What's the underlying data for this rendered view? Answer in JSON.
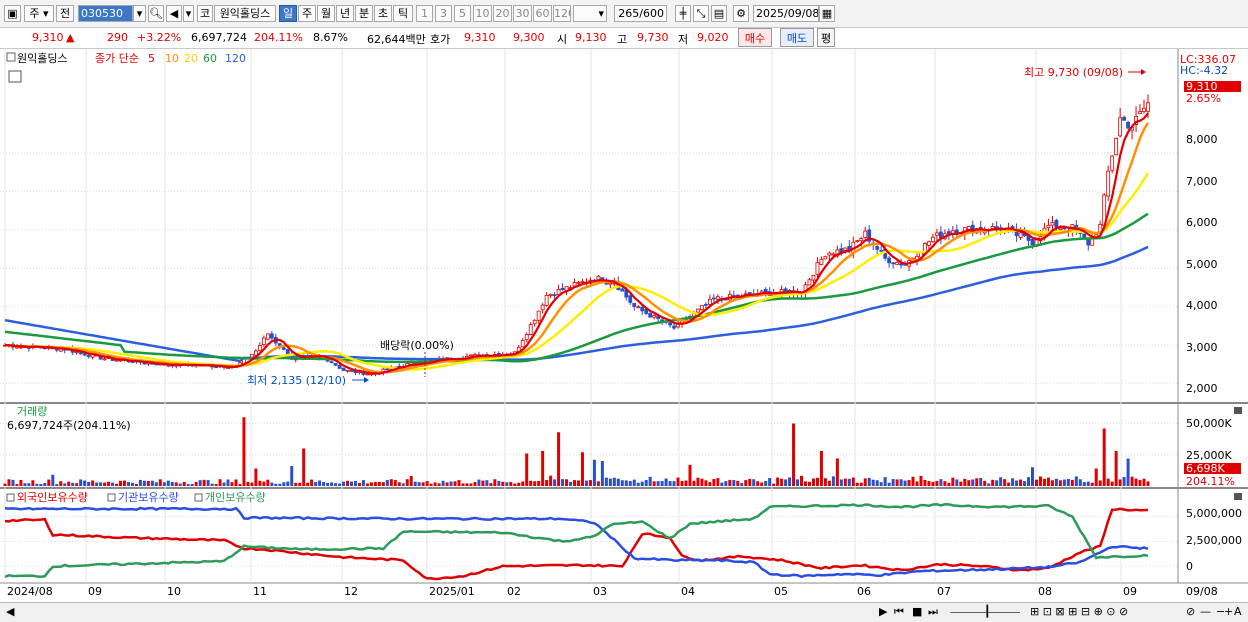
{
  "toolbar": {
    "market": "주",
    "prev": "전",
    "code": "030530",
    "market_type": "코",
    "name": "원익홀딩스",
    "periods": [
      "일",
      "주",
      "월",
      "년",
      "분",
      "초",
      "틱"
    ],
    "period_selected": "일",
    "nums": [
      "1",
      "3",
      "5",
      "10",
      "20",
      "30",
      "60",
      "120"
    ],
    "count": "265",
    "count_max": "/600",
    "date": "2025/09/08"
  },
  "info": {
    "price": "9,310",
    "arrow": "▲",
    "change": "290",
    "change_pct": "+3.22%",
    "volume": "6,697,724",
    "vol_ratio": "204.11%",
    "turnover": "8.67%",
    "amount": "62,644백만",
    "quote_label": "호가",
    "ask": "9,310",
    "bid": "9,300",
    "open_label": "시",
    "open": "9,130",
    "high_label": "고",
    "high": "9,730",
    "low_label": "저",
    "low": "9,020",
    "buy": "매수",
    "sell": "매도",
    "avg": "평"
  },
  "colors": {
    "up": "#e00000",
    "down": "#2a50c8",
    "ma5": "#e00000",
    "ma10": "#ff9000",
    "ma20": "#ffee00",
    "ma60": "#1a9a40",
    "ma120": "#2a60e0",
    "foreign": "#e00000",
    "inst": "#2a4ee0",
    "indiv": "#2e9a5a"
  },
  "chart_data": [
    {
      "type": "candlestick",
      "title": "원익홀딩스",
      "legend": {
        "label": "종가 단순",
        "ma": [
          "5",
          "10",
          "20",
          "60",
          "120"
        ]
      },
      "x_labels": [
        "2024/08",
        "09",
        "10",
        "11",
        "12",
        "2025/01",
        "02",
        "03",
        "04",
        "05",
        "06",
        "07",
        "08",
        "09"
      ],
      "y_ticks": [
        "8,000",
        "7,000",
        "6,000",
        "5,000",
        "4,000",
        "3,000",
        "2,000"
      ],
      "ylim": [
        1600,
        10500
      ],
      "annotations": {
        "high": "최고 9,730 (09/08)",
        "low": "최저 2,135 (12/10)",
        "dividend": "배당락(0.00%)",
        "lc": "LC:336.07",
        "hc": "HC:-4.32",
        "last": "9,310",
        "last_pct": "2.65%"
      },
      "anchors": [
        [
          0,
          3000
        ],
        [
          15,
          2900
        ],
        [
          25,
          2650
        ],
        [
          40,
          2500
        ],
        [
          58,
          2450
        ],
        [
          63,
          2850
        ],
        [
          66,
          3300
        ],
        [
          72,
          2650
        ],
        [
          80,
          2700
        ],
        [
          85,
          2350
        ],
        [
          92,
          2250
        ],
        [
          100,
          2480
        ],
        [
          105,
          2560
        ],
        [
          115,
          2700
        ],
        [
          128,
          2800
        ],
        [
          133,
          3700
        ],
        [
          136,
          4300
        ],
        [
          148,
          4750
        ],
        [
          153,
          4650
        ],
        [
          158,
          4000
        ],
        [
          168,
          3450
        ],
        [
          178,
          4200
        ],
        [
          190,
          4350
        ],
        [
          200,
          4400
        ],
        [
          206,
          5400
        ],
        [
          212,
          5500
        ],
        [
          216,
          5900
        ],
        [
          221,
          5250
        ],
        [
          226,
          5100
        ],
        [
          233,
          5800
        ],
        [
          238,
          6000
        ],
        [
          250,
          6050
        ],
        [
          258,
          5700
        ],
        [
          262,
          6100
        ],
        [
          268,
          6050
        ],
        [
          272,
          5650
        ],
        [
          275,
          6100
        ],
        [
          277,
          7500
        ],
        [
          280,
          8900
        ],
        [
          283,
          8700
        ],
        [
          287,
          9310
        ]
      ]
    },
    {
      "type": "bar",
      "title": "거래량",
      "readout": "6,697,724주(204.11%)",
      "y_ticks": [
        "50,000K",
        "25,000K",
        "0"
      ],
      "ylim": [
        0,
        60000
      ],
      "last": "6,698K",
      "last_pct": "204.11%",
      "spikes": [
        [
          12,
          9000
        ],
        [
          60,
          55000
        ],
        [
          63,
          14000
        ],
        [
          72,
          16000
        ],
        [
          75,
          30000
        ],
        [
          102,
          8000
        ],
        [
          131,
          26000
        ],
        [
          135,
          28000
        ],
        [
          139,
          43000
        ],
        [
          145,
          27000
        ],
        [
          148,
          21000
        ],
        [
          150,
          20000
        ],
        [
          172,
          17000
        ],
        [
          198,
          50000
        ],
        [
          205,
          28000
        ],
        [
          209,
          22000
        ],
        [
          258,
          15000
        ],
        [
          274,
          14000
        ],
        [
          276,
          46000
        ],
        [
          279,
          28000
        ],
        [
          282,
          22000
        ]
      ]
    },
    {
      "type": "line",
      "legend": [
        "외국인보유수량",
        "기관보유수량",
        "개인보유수량"
      ],
      "y_ticks": [
        "5,000,000",
        "2,500,000",
        "0"
      ],
      "ylim": [
        -1500000,
        6800000
      ],
      "series": [
        {
          "name": "외국인보유수량",
          "anchors": [
            [
              0,
              4600000
            ],
            [
              10,
              4700000
            ],
            [
              12,
              3200000
            ],
            [
              30,
              2900000
            ],
            [
              55,
              2600000
            ],
            [
              60,
              1800000
            ],
            [
              65,
              1700000
            ],
            [
              75,
              1300000
            ],
            [
              85,
              900000
            ],
            [
              100,
              600000
            ],
            [
              106,
              -1300000
            ],
            [
              115,
              -1000000
            ],
            [
              125,
              0
            ],
            [
              145,
              100000
            ],
            [
              155,
              0
            ],
            [
              160,
              3300000
            ],
            [
              167,
              2900000
            ],
            [
              170,
              1000000
            ],
            [
              175,
              600000
            ],
            [
              185,
              1000000
            ],
            [
              195,
              600000
            ],
            [
              205,
              -200000
            ],
            [
              215,
              100000
            ],
            [
              225,
              -400000
            ],
            [
              235,
              200000
            ],
            [
              245,
              0
            ],
            [
              255,
              -400000
            ],
            [
              262,
              -200000
            ],
            [
              270,
              1400000
            ],
            [
              275,
              2000000
            ],
            [
              278,
              5800000
            ],
            [
              287,
              5600000
            ]
          ]
        },
        {
          "name": "기관보유수량",
          "anchors": [
            [
              0,
              5800000
            ],
            [
              58,
              5800000
            ],
            [
              60,
              4900000
            ],
            [
              100,
              4800000
            ],
            [
              140,
              4800000
            ],
            [
              148,
              4400000
            ],
            [
              152,
              3000000
            ],
            [
              158,
              800000
            ],
            [
              168,
              600000
            ],
            [
              178,
              600000
            ],
            [
              188,
              400000
            ],
            [
              192,
              -800000
            ],
            [
              200,
              -1000000
            ],
            [
              210,
              -800000
            ],
            [
              220,
              -900000
            ],
            [
              230,
              -500000
            ],
            [
              250,
              -300000
            ],
            [
              262,
              -100000
            ],
            [
              270,
              400000
            ],
            [
              278,
              2000000
            ],
            [
              287,
              1800000
            ]
          ]
        },
        {
          "name": "개인보유수량",
          "anchors": [
            [
              0,
              -1000000
            ],
            [
              10,
              -1000000
            ],
            [
              12,
              0
            ],
            [
              55,
              500000
            ],
            [
              60,
              2000000
            ],
            [
              75,
              1700000
            ],
            [
              95,
              1800000
            ],
            [
              100,
              3500000
            ],
            [
              125,
              3400000
            ],
            [
              140,
              2500000
            ],
            [
              148,
              3000000
            ],
            [
              152,
              4200000
            ],
            [
              160,
              4500000
            ],
            [
              167,
              2800000
            ],
            [
              172,
              4300000
            ],
            [
              188,
              4800000
            ],
            [
              192,
              6000000
            ],
            [
              215,
              6200000
            ],
            [
              225,
              6000000
            ],
            [
              235,
              6200000
            ],
            [
              250,
              6000000
            ],
            [
              262,
              6100000
            ],
            [
              268,
              5000000
            ],
            [
              274,
              900000
            ],
            [
              287,
              1100000
            ]
          ]
        }
      ]
    }
  ],
  "bottom": {
    "date": "09/08"
  }
}
